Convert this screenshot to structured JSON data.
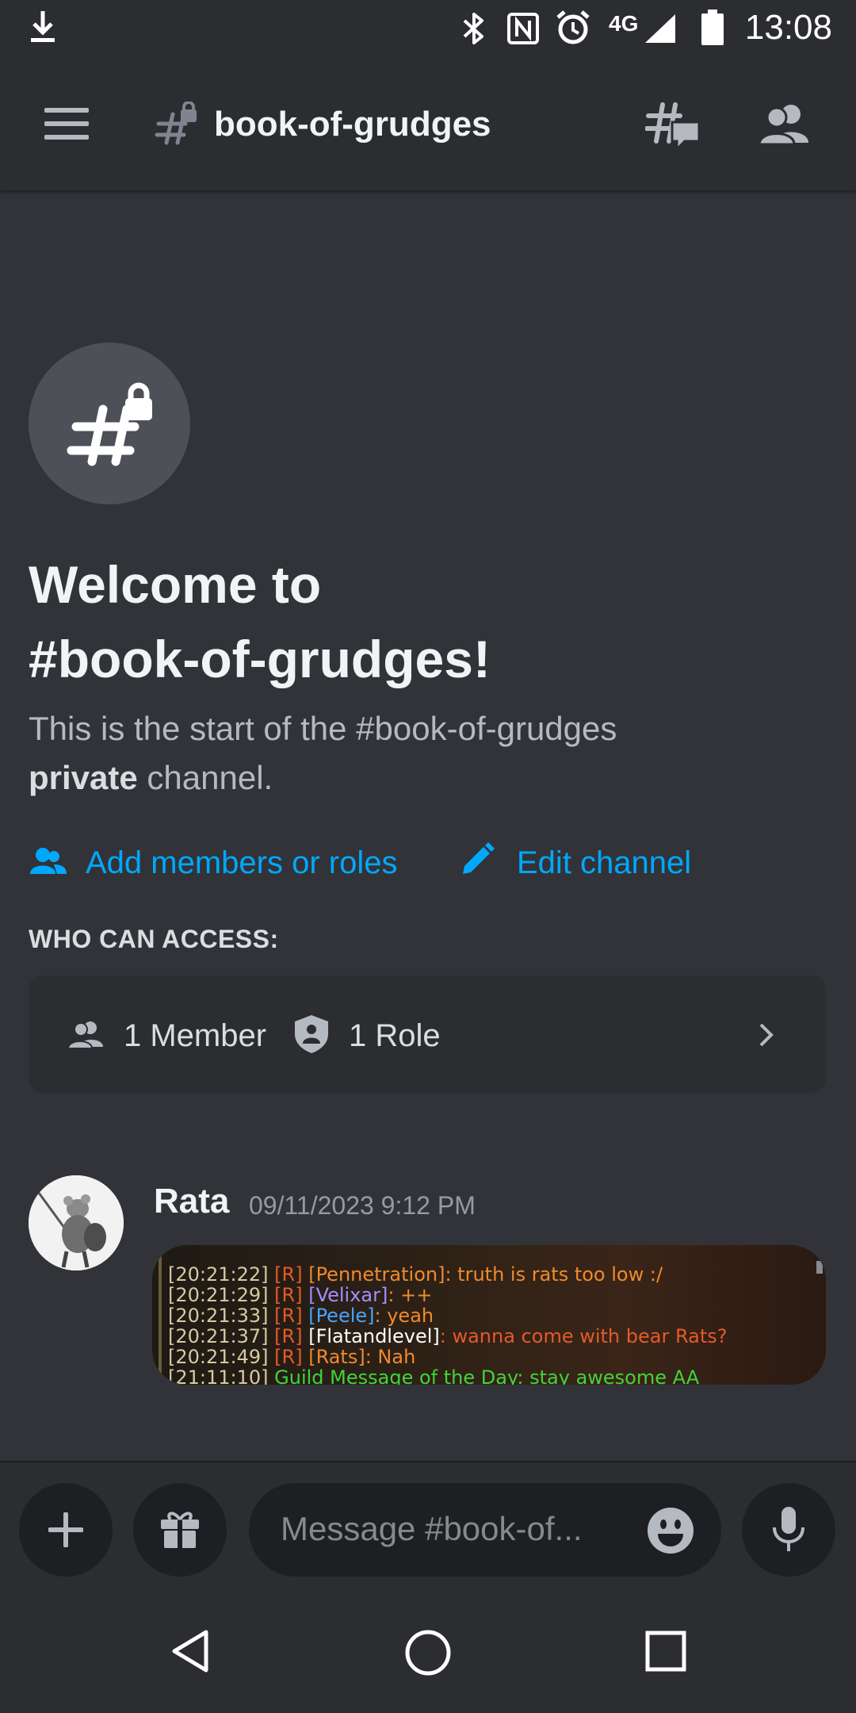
{
  "status_bar": {
    "time": "13:08",
    "network": "4G",
    "icons": [
      "download-icon",
      "bluetooth-icon",
      "nfc-icon",
      "alarm-icon",
      "signal-icon",
      "battery-icon"
    ]
  },
  "header": {
    "channel_name": "book-of-grudges",
    "icons": [
      "menu-icon",
      "locked-channel-icon",
      "threads-icon",
      "members-icon"
    ]
  },
  "intro": {
    "welcome_line1": "Welcome to",
    "welcome_line2": "#book-of-grudges!",
    "desc_start": "This is the start of the #book-of-grudges",
    "desc_bold": "private",
    "desc_end": " channel.",
    "add_members_label": "Add members or roles",
    "edit_channel_label": "Edit channel",
    "who_can_access_label": "WHO CAN ACCESS:",
    "member_count_label": "1 Member",
    "role_count_label": "1 Role"
  },
  "message": {
    "author": "Rata",
    "timestamp": "09/11/2023 9:12 PM",
    "attachment_lines": [
      {
        "time": "[20:21:22]",
        "tag": "[R]",
        "name": "[Pennetration]",
        "text": ": truth is rats too low :/"
      },
      {
        "time": "[20:21:29]",
        "tag": "[R]",
        "name": "[Velixar]",
        "text": ": ++"
      },
      {
        "time": "[20:21:33]",
        "tag": "[R]",
        "name": "[Peele]",
        "text": ": yeah"
      },
      {
        "time": "[20:21:37]",
        "tag": "[R]",
        "name": "[Flatandlevel]",
        "text": ": wanna come with bear Rats?"
      },
      {
        "time": "[20:21:49]",
        "tag": "[R]",
        "name": "[Rats]",
        "text": ": Nah"
      },
      {
        "time": "[21:11:10]",
        "tag": "",
        "name": "",
        "text": "Guild Message of the Day: stay awesome AA"
      }
    ]
  },
  "composer": {
    "placeholder": "Message #book-of..."
  },
  "nav": {
    "icons": [
      "back-icon",
      "home-icon",
      "recents-icon"
    ]
  },
  "colors": {
    "background": "#313338",
    "surface": "#2b2d31",
    "input": "#1e1f22",
    "link": "#00a8fc",
    "muted": "#b5bac1"
  }
}
